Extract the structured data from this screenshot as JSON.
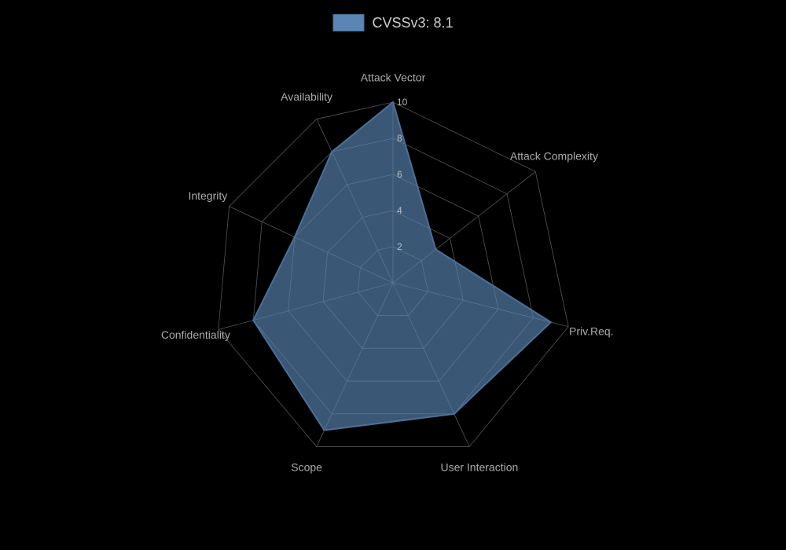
{
  "chart": {
    "title": "CVSSv3: 8.1",
    "color": "#5b85b5",
    "colorStroke": "#4a7199",
    "center": [
      500,
      360
    ],
    "maxRadius": 230,
    "gridLevels": [
      2,
      4,
      6,
      8,
      10
    ],
    "axes": [
      {
        "label": "Attack Vector",
        "angle": -90,
        "value": 10
      },
      {
        "label": "Attack Complexity",
        "angle": -38,
        "value": 3
      },
      {
        "label": "Priv.Req.",
        "angle": 14,
        "value": 9
      },
      {
        "label": "User Interaction",
        "angle": 65,
        "value": 8
      },
      {
        "label": "Scope",
        "angle": 115,
        "value": 9
      },
      {
        "label": "Confidentiality",
        "angle": 165,
        "value": 8
      },
      {
        "label": "Integrity",
        "angle": 205,
        "value": 6
      },
      {
        "label": "Availability",
        "angle": 245,
        "value": 8
      }
    ]
  }
}
